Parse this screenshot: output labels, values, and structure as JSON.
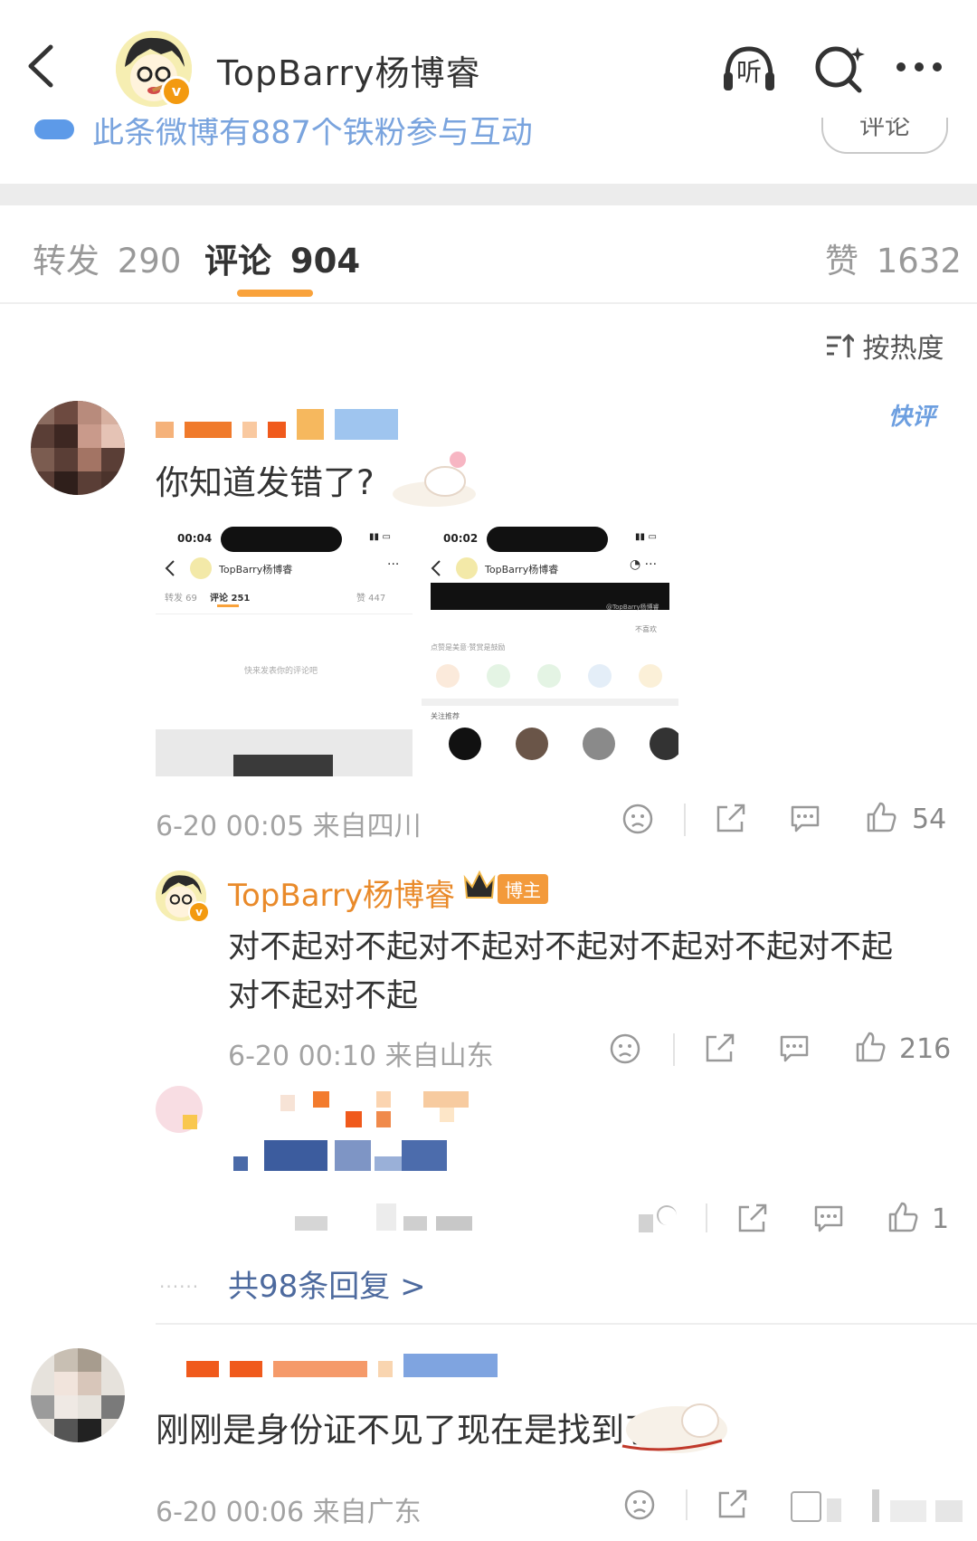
{
  "header": {
    "title": "TopBarry杨博睿",
    "listen_label": "听"
  },
  "banner": {
    "text": "此条微博有887个铁粉参与互动",
    "button": "评论"
  },
  "tabs": [
    {
      "label": "转发",
      "count": "290"
    },
    {
      "label": "评论",
      "count": "904"
    },
    {
      "label": "赞",
      "count": "1632"
    }
  ],
  "sort_label": "按热度",
  "comments": [
    {
      "text": "你知道发错了?",
      "badge": "快评",
      "meta": "6-20 00:05 来自四川",
      "likes": "54",
      "screenshot_left": {
        "time": "00:04",
        "account": "TopBarry杨博睿",
        "repost": "转发 69",
        "comments": "评论 251",
        "likes": "赞 447",
        "empty": "快来发表你的评论吧"
      },
      "screenshot_right": {
        "time": "00:02",
        "account": "TopBarry杨博睿",
        "watermark": "@TopBarry杨博睿",
        "dislike": "不喜欢",
        "share_hint": "点赞是美意·赞赏是鼓励",
        "recommend": "关注推荐"
      }
    }
  ],
  "reply": {
    "author": "TopBarry杨博睿",
    "role": "博主",
    "text_line1": "对不起对不起对不起对不起对不起对不起对不起",
    "text_line2": "对不起对不起",
    "meta": "6-20 00:10 来自山东",
    "likes": "216"
  },
  "reply2": {
    "likes": "1"
  },
  "more_replies": "共98条回复 >",
  "comment2": {
    "text": "刚刚是身份证不见了现在是找到了",
    "meta": "6-20 00:06 来自广东"
  },
  "colors": {
    "accent": "#f9a23b",
    "link": "#e98a2a",
    "banner": "#7aa4de"
  }
}
